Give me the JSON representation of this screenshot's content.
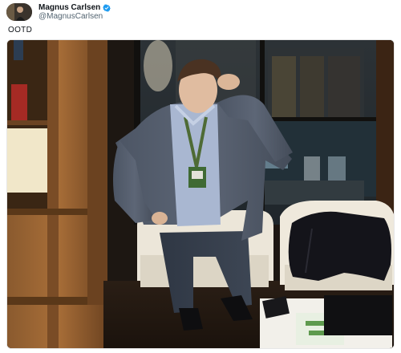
{
  "author": {
    "display_name": "Magnus Carlsen",
    "handle": "@MagnusCarlsen",
    "verified": true,
    "verified_color": "#1d9bf0"
  },
  "tweet": {
    "text": "OOTD"
  },
  "media": {
    "icon": "photo",
    "description_icon": "person-photo"
  },
  "colors": {
    "text_primary": "#0f1419",
    "text_secondary": "#536471",
    "background": "#ffffff"
  }
}
